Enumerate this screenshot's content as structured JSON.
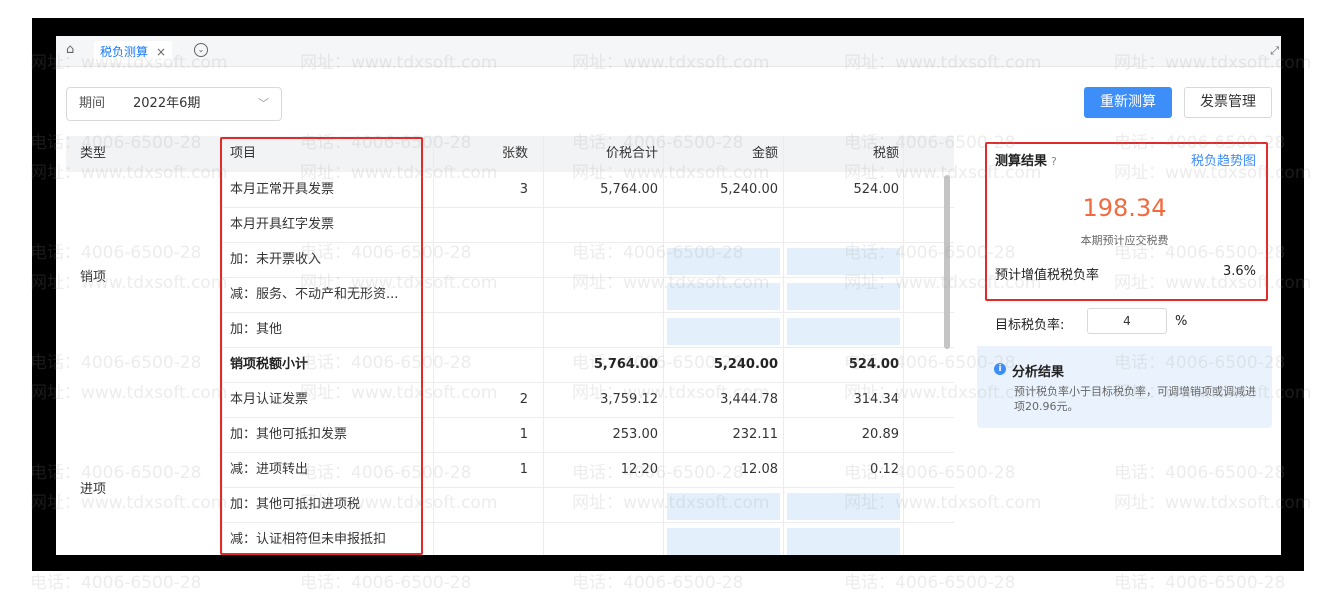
{
  "tabbar": {
    "active_tab": "税负测算",
    "close_glyph": "×"
  },
  "toolbar": {
    "period_label": "期间",
    "period_value": "2022年6期",
    "recalc_button": "重新测算",
    "invoice_button": "发票管理"
  },
  "table": {
    "headers": {
      "type": "类型",
      "item": "项目",
      "count": "张数",
      "total": "价税合计",
      "amount": "金额",
      "tax": "税额"
    },
    "groups": {
      "output": "销项",
      "input": "进项"
    },
    "rows": [
      {
        "item": "本月正常开具发票",
        "count": "3",
        "total": "5,764.00",
        "amount": "5,240.00",
        "tax": "524.00"
      },
      {
        "item": "本月开具红字发票",
        "count": "",
        "total": "",
        "amount": "",
        "tax": ""
      },
      {
        "item": "加：未开票收入",
        "count": "",
        "total": "",
        "amount": "",
        "tax": ""
      },
      {
        "item": "减：服务、不动产和无形资...",
        "count": "",
        "total": "",
        "amount": "",
        "tax": ""
      },
      {
        "item": "加：其他",
        "count": "",
        "total": "",
        "amount": "",
        "tax": ""
      },
      {
        "item": "销项税额小计",
        "count": "",
        "total": "5,764.00",
        "amount": "5,240.00",
        "tax": "524.00"
      },
      {
        "item": "本月认证发票",
        "count": "2",
        "total": "3,759.12",
        "amount": "3,444.78",
        "tax": "314.34"
      },
      {
        "item": "加：其他可抵扣发票",
        "count": "1",
        "total": "253.00",
        "amount": "232.11",
        "tax": "20.89"
      },
      {
        "item": "减：进项转出",
        "count": "1",
        "total": "12.20",
        "amount": "12.08",
        "tax": "0.12"
      },
      {
        "item": "加：其他可抵扣进项税",
        "count": "",
        "total": "",
        "amount": "",
        "tax": ""
      },
      {
        "item": "减：认证相符但未申报抵扣",
        "count": "",
        "total": "",
        "amount": "",
        "tax": ""
      }
    ]
  },
  "panel": {
    "title": "测算结果",
    "help_glyph": "?",
    "trend_link": "税负趋势图",
    "estimated_tax": "198.34",
    "estimated_tax_label": "本期预计应交税费",
    "vat_rate_label": "预计增值税税负率",
    "vat_rate_value": "3.6%",
    "target_label": "目标税负率:",
    "target_value": "4",
    "target_unit": "%",
    "analysis_title": "分析结果",
    "analysis_text": "预计税负率小于目标税负率，可调增销项或调减进项20.96元。"
  },
  "watermark": {
    "phone": "电话：4006-6500-28",
    "url": "网址：www.tdxsoft.com"
  },
  "colors": {
    "primary": "#3d8ef8",
    "highlight_border": "#e12b2b",
    "result_number": "#f26a3d",
    "editable_cell": "#e3f0fb"
  }
}
